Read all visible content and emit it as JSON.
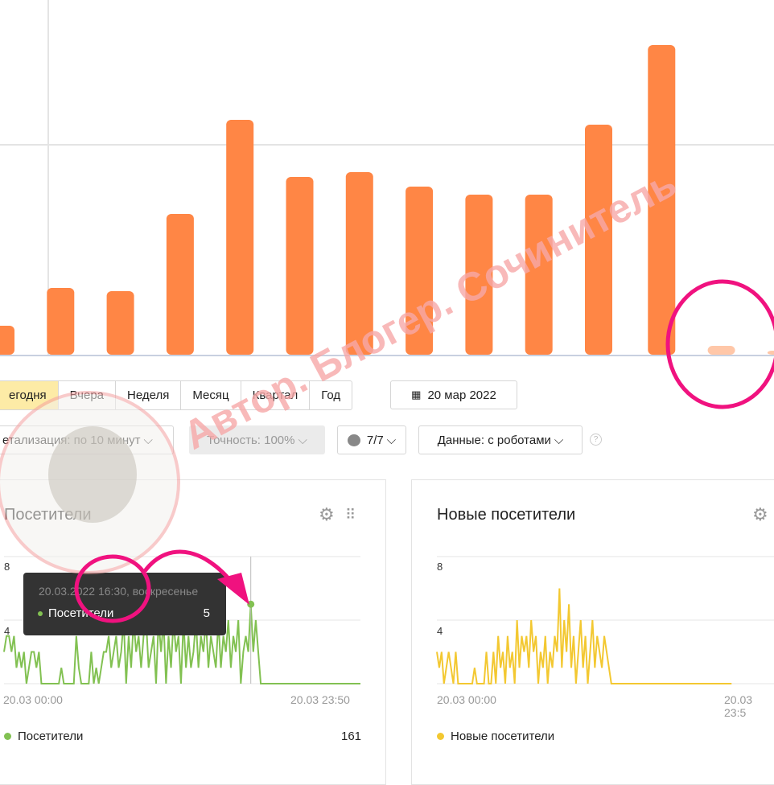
{
  "top_chart": {
    "type": "bar",
    "values": [
      36,
      83,
      79,
      175,
      292,
      221,
      227,
      209,
      199,
      199,
      286,
      385,
      11,
      5
    ],
    "faded_from_index": 12,
    "color": "#ff8645",
    "faded_color": "#ffc7a8",
    "ylim": [
      0,
      400
    ]
  },
  "periods": {
    "items": [
      "егодня",
      "Вчера",
      "Неделя",
      "Месяц",
      "Квартал",
      "Год"
    ],
    "active": 0
  },
  "date_button": {
    "icon": "calendar-icon",
    "label": "20 мар 2022"
  },
  "filters": {
    "detail": "етализация: по 10 минут",
    "accuracy": "Точность: 100%",
    "segments": "7/7",
    "data": "Данные: с роботами",
    "help": "?"
  },
  "widgets": [
    {
      "title": "Посетители",
      "color": "#82c152",
      "y_ticks": [
        "8",
        "4"
      ],
      "x_start": "20.03 00:00",
      "x_end": "20.03 23:50",
      "legend": "Посетители",
      "total": "161",
      "tooltip": {
        "date": "20.03.2022 16:30, воскресенье",
        "series": "Посетители",
        "value": "5"
      },
      "highlight_index": 99,
      "values": [
        2,
        3,
        3,
        2,
        3,
        1,
        2,
        1,
        2,
        0,
        1,
        2,
        2,
        1,
        2,
        0,
        0,
        0,
        0,
        0,
        0,
        0,
        0,
        1,
        0,
        0,
        0,
        0,
        0,
        3,
        1,
        0,
        0,
        0,
        0,
        2,
        0,
        1,
        0,
        1,
        2,
        2,
        3,
        1,
        2,
        3,
        1,
        2,
        4,
        0,
        3,
        1,
        4,
        2,
        3,
        1,
        3,
        4,
        1,
        2,
        3,
        0,
        4,
        2,
        4,
        0,
        3,
        1,
        4,
        2,
        3,
        0,
        4,
        1,
        3,
        1,
        2,
        4,
        1,
        3,
        2,
        4,
        1,
        3,
        2,
        1,
        4,
        1,
        3,
        2,
        4,
        1,
        3,
        2,
        4,
        0,
        2,
        3,
        2,
        5,
        2,
        4,
        2,
        0,
        0,
        0,
        0,
        0,
        0,
        0,
        0,
        0,
        0,
        0,
        0,
        0,
        0,
        0,
        0,
        0,
        0,
        0,
        0,
        0,
        0,
        0,
        0,
        0,
        0,
        0,
        0,
        0,
        0,
        0,
        0,
        0,
        0,
        0,
        0,
        0,
        0,
        0,
        0,
        0
      ]
    },
    {
      "title": "Новые посетители",
      "color": "#f3c831",
      "y_ticks": [
        "8",
        "4"
      ],
      "x_start": "20.03 00:00",
      "x_end": "20.03 23:5",
      "legend": "Новые посетители",
      "values": [
        2,
        1,
        2,
        0,
        1,
        2,
        1,
        0,
        2,
        0,
        0,
        0,
        0,
        0,
        0,
        0,
        1,
        0,
        0,
        0,
        0,
        2,
        0,
        0,
        2,
        0,
        3,
        1,
        2,
        0,
        3,
        1,
        2,
        0,
        4,
        1,
        3,
        2,
        3,
        1,
        4,
        2,
        3,
        0,
        2,
        1,
        3,
        0,
        2,
        1,
        3,
        2,
        6,
        1,
        4,
        2,
        5,
        1,
        3,
        0,
        2,
        4,
        1,
        3,
        0,
        2,
        4,
        1,
        3,
        2,
        1,
        3,
        2,
        1,
        0,
        0,
        0,
        0,
        0,
        0,
        0,
        0,
        0,
        0,
        0,
        0,
        0,
        0,
        0,
        0,
        0,
        0,
        0,
        0,
        0,
        0,
        0,
        0,
        0,
        0,
        0,
        0,
        0,
        0,
        0,
        0,
        0,
        0,
        0,
        0,
        0,
        0,
        0,
        0,
        0,
        0,
        0,
        0,
        0,
        0,
        0,
        0,
        0,
        0,
        0,
        0
      ]
    }
  ],
  "watermark": "Автор. Блогер. Сочинитель",
  "annotation_color": "#f0127f"
}
